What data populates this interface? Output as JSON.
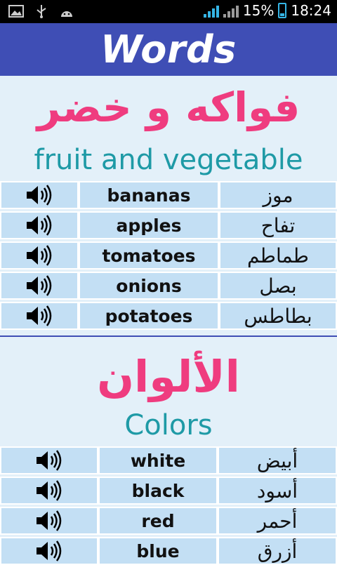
{
  "status_bar": {
    "battery_percent": "15%",
    "time": "18:24",
    "accent_color": "#35b5e5"
  },
  "header": {
    "title": "Words",
    "background": "#3f4eb5"
  },
  "sections": [
    {
      "title_ar": "فواكه و خضر",
      "title_en": "fruit and vegetable",
      "words": [
        {
          "en": "bananas",
          "ar": "موز"
        },
        {
          "en": "apples",
          "ar": "تفاح"
        },
        {
          "en": "tomatoes",
          "ar": "طماطم"
        },
        {
          "en": "onions",
          "ar": "بصل"
        },
        {
          "en": "potatoes",
          "ar": "بطاطس"
        }
      ]
    },
    {
      "title_ar": "الألوان",
      "title_en": "Colors",
      "words": [
        {
          "en": "white",
          "ar": "أبيض"
        },
        {
          "en": "black",
          "ar": "أسود"
        },
        {
          "en": "red",
          "ar": "أحمر"
        },
        {
          "en": "blue",
          "ar": "أزرق"
        }
      ]
    }
  ],
  "colors": {
    "title_ar": "#ef3c7f",
    "title_en": "#1e9aa6",
    "cell": "#c3dff4",
    "page": "#e3f0f9"
  }
}
